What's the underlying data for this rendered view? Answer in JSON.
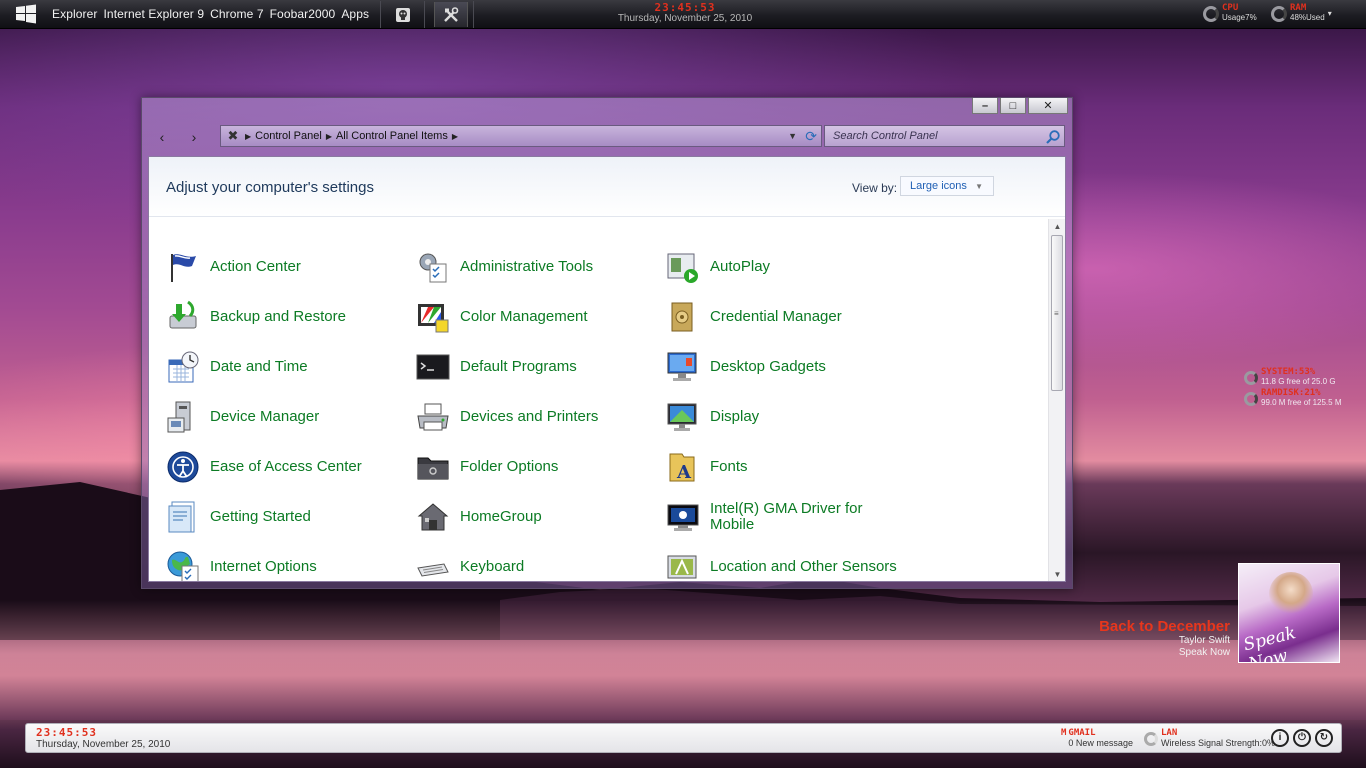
{
  "taskbar": {
    "menu_items": [
      "Explorer",
      "Internet Explorer 9",
      "Chrome 7",
      "Foobar2000",
      "Apps"
    ],
    "dock_icons": [
      "skull-icon",
      "tools-icon"
    ],
    "clock_time": "23:45:53",
    "clock_date": "Thursday, November 25, 2010",
    "cpu_label": "CPU",
    "cpu_value": "Usage7%",
    "ram_label": "RAM",
    "ram_value": "48%Used"
  },
  "window": {
    "controls": {
      "minimize": "–",
      "maximize": "□",
      "close": "✕"
    },
    "nav": {
      "back": "‹",
      "forward": "›"
    },
    "breadcrumb": [
      "Control Panel",
      "All Control Panel Items"
    ],
    "search_placeholder": "Search Control Panel",
    "title": "Adjust your computer's settings",
    "view_by_label": "View by:",
    "view_by_value": "Large icons",
    "items": [
      {
        "label": "Action Center",
        "icon": "flag-icon"
      },
      {
        "label": "Administrative Tools",
        "icon": "admin-tools-icon"
      },
      {
        "label": "AutoPlay",
        "icon": "autoplay-icon"
      },
      {
        "label": "Backup and Restore",
        "icon": "backup-icon"
      },
      {
        "label": "Color Management",
        "icon": "color-management-icon"
      },
      {
        "label": "Credential Manager",
        "icon": "credential-vault-icon"
      },
      {
        "label": "Date and Time",
        "icon": "calendar-clock-icon"
      },
      {
        "label": "Default Programs",
        "icon": "terminal-icon"
      },
      {
        "label": "Desktop Gadgets",
        "icon": "desktop-gadgets-icon"
      },
      {
        "label": "Device Manager",
        "icon": "device-manager-icon"
      },
      {
        "label": "Devices and Printers",
        "icon": "printer-icon"
      },
      {
        "label": "Display",
        "icon": "monitor-icon"
      },
      {
        "label": "Ease of Access Center",
        "icon": "accessibility-icon"
      },
      {
        "label": "Folder Options",
        "icon": "folder-icon"
      },
      {
        "label": "Fonts",
        "icon": "fonts-icon"
      },
      {
        "label": "Getting Started",
        "icon": "getting-started-icon"
      },
      {
        "label": "HomeGroup",
        "icon": "homegroup-icon"
      },
      {
        "label": "Intel(R) GMA Driver for Mobile",
        "icon": "intel-gma-icon"
      },
      {
        "label": "Internet Options",
        "icon": "globe-icon"
      },
      {
        "label": "Keyboard",
        "icon": "keyboard-icon"
      },
      {
        "label": "Location and Other Sensors",
        "icon": "sensors-icon"
      }
    ]
  },
  "desktop": {
    "system_label": "SYSTEM:53%",
    "system_value": "11.8 G free of 25.0 G",
    "ramdisk_label": "RAMDISK:21%",
    "ramdisk_value": "99.0 M free of 125.5 M",
    "song": "Back to December",
    "artist": "Taylor Swift",
    "album": "Speak Now",
    "album_art_title": "Speak Now"
  },
  "bottombar": {
    "clock_time": "23:45:53",
    "clock_date": "Thursday, November 25, 2010",
    "gmail_label": "GMAIL",
    "gmail_value": "0 New message",
    "lan_label": "LAN",
    "lan_value": "Wireless Signal Strength:0%"
  },
  "colors": {
    "accent_red": "#e0301e",
    "link_green": "#0c7b24",
    "link_blue": "#1f5fb4"
  }
}
